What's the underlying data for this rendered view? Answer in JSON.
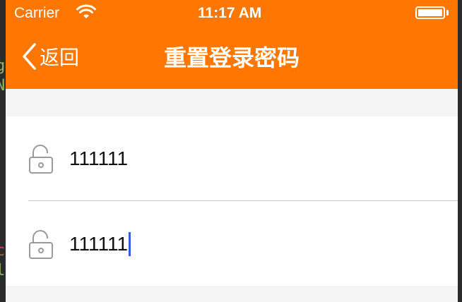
{
  "status_bar": {
    "carrier": "Carrier",
    "time": "11:17 AM"
  },
  "nav": {
    "back_label": "返回",
    "title": "重置登录密码"
  },
  "form": {
    "fields": [
      {
        "value": "111111",
        "focused": false,
        "icon": "unlock-icon"
      },
      {
        "value": "111111",
        "focused": true,
        "icon": "unlock-icon"
      }
    ]
  },
  "colors": {
    "nav_background": "#ff7700",
    "page_background": "#f5f5f5",
    "caret": "#3d5ad6"
  }
}
